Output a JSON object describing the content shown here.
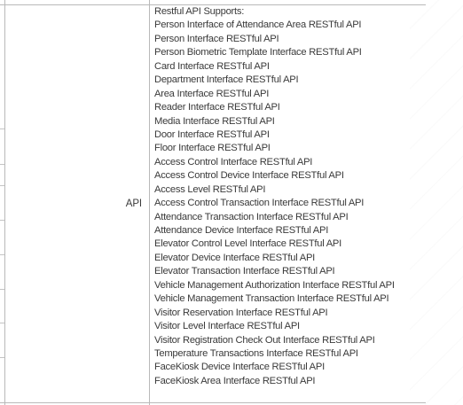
{
  "table": {
    "row_label": "API",
    "lines": [
      "Restful API Supports:",
      "Person Interface of Attendance Area RESTful API",
      "Person Interface RESTful API",
      "Person Biometric Template Interface RESTful API",
      "Card Interface RESTful API",
      "Department Interface RESTful API",
      "Area Interface RESTful API",
      "Reader Interface RESTful API",
      "Media Interface RESTful API",
      "Door Interface RESTful API",
      "Floor Interface RESTful API",
      "Access Control Interface RESTful API",
      "Access Control Device Interface RESTful API",
      "Access Level RESTful API",
      "Access Control Transaction Interface RESTful API",
      "Attendance Transaction Interface RESTful API",
      "Attendance Device Interface RESTful API",
      "Elevator Control Level Interface RESTful API",
      "Elevator Device Interface RESTful API",
      "Elevator Transaction Interface RESTful API",
      "Vehicle Management Authorization Interface RESTful API",
      "Vehicle Management Transaction Interface RESTful API",
      "Visitor Reservation Interface RESTful API",
      "Visitor Level Interface RESTful API",
      "Visitor Registration Check Out Interface RESTful API",
      "Temperature Transactions Interface RESTful API",
      "FaceKiosk Device Interface RESTful API",
      "FaceKiosk Area Interface RESTful API"
    ]
  }
}
